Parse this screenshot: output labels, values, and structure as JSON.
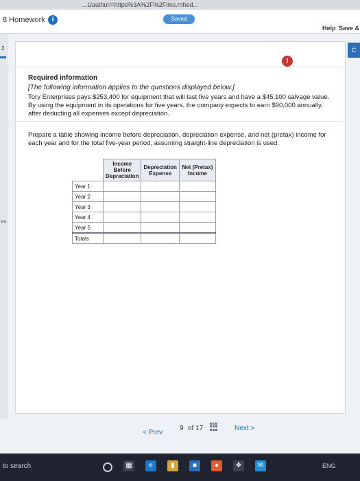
{
  "browser": {
    "url_fragment": "...Uauthurl=https%3A%2F%2Fims.mhed..."
  },
  "header": {
    "title": "8 Homework",
    "info_icon_text": "i",
    "saved_label": "Saved",
    "help_label": "Help",
    "save_label": "Save &",
    "check_label": "C"
  },
  "sidebar": {
    "question_number": "2",
    "truncated_label": "es"
  },
  "content": {
    "alert_icon_text": "!",
    "required_title": "Required information",
    "required_note": "[The following information applies to the questions displayed below.]",
    "required_body": "Tory Enterprises pays $253,400 for equipment that will last five years and have a $45,100 salvage value. By using the equipment in its operations for five years, the company expects to earn $90,000 annually, after deducting all expenses except depreciation.",
    "prompt": "Prepare a table showing income before depreciation, depreciation expense, and net (pretax) income for each year and for the total five-year period, assuming straight-line depreciation is used."
  },
  "table": {
    "headers": [
      "",
      "Income Before Depreciation",
      "Depreciation Expense",
      "Net (Pretax) Income"
    ],
    "rows": [
      {
        "label": "Year 1",
        "values": [
          "",
          "",
          ""
        ]
      },
      {
        "label": "Year 2",
        "values": [
          "",
          "",
          ""
        ]
      },
      {
        "label": "Year 3",
        "values": [
          "",
          "",
          ""
        ]
      },
      {
        "label": "Year 4",
        "values": [
          "",
          "",
          ""
        ]
      },
      {
        "label": "Year 5",
        "values": [
          "",
          "",
          ""
        ]
      },
      {
        "label": "Totals",
        "values": [
          "",
          "",
          ""
        ]
      }
    ]
  },
  "pagination": {
    "prev_label": "< Prev",
    "current_page": "9",
    "of_label": "of 17",
    "next_label": "Next >"
  },
  "taskbar": {
    "search_text": "to search",
    "tray_text": "ENG"
  },
  "colors": {
    "accent": "#1b6ec2",
    "alert": "#c0392b",
    "saved": "#4a90d9"
  }
}
